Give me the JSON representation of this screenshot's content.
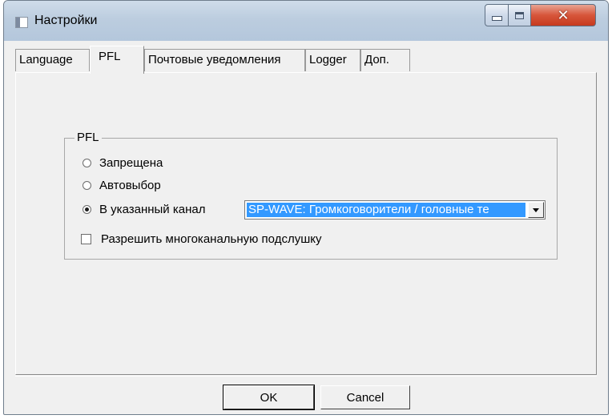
{
  "window": {
    "title": "Настройки"
  },
  "tabs": [
    {
      "label": "Language"
    },
    {
      "label": "PFL"
    },
    {
      "label": "Почтовые уведомления"
    },
    {
      "label": "Logger"
    },
    {
      "label": "Доп."
    }
  ],
  "selected_tab": "PFL",
  "pfl_group": {
    "legend": "PFL",
    "options": [
      {
        "label": "Запрещена",
        "checked": false
      },
      {
        "label": "Автовыбор",
        "checked": false
      },
      {
        "label": "В указанный канал",
        "checked": true
      }
    ],
    "channel_select": {
      "value": "SP-WAVE: Громкоговорители / головные те"
    },
    "multichannel_checkbox": {
      "label": "Разрешить многоканальную подслушку",
      "checked": false
    }
  },
  "buttons": {
    "ok": "OK",
    "cancel": "Cancel"
  },
  "colors": {
    "selection": "#3399ff",
    "close_button": "#d7553a",
    "titlebar": "#bccddf"
  }
}
